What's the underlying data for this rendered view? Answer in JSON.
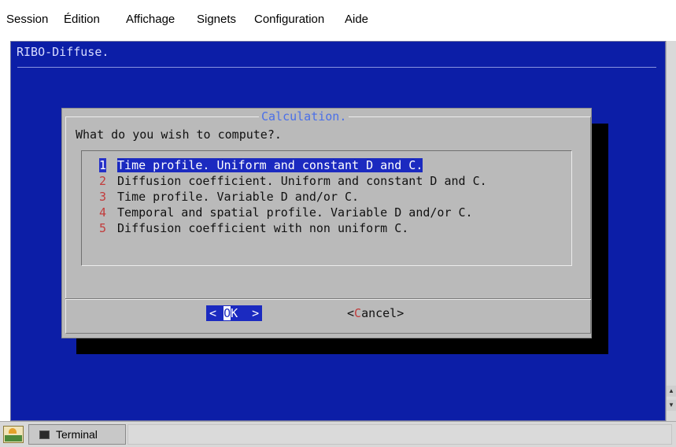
{
  "menubar": {
    "items": [
      "Session",
      "Édition",
      "Affichage",
      "Signets",
      "Configuration",
      "Aide"
    ]
  },
  "terminal": {
    "app_title": "RIBO-Diffuse."
  },
  "dialog": {
    "title": "Calculation.",
    "prompt": "What do you wish to compute?.",
    "items": [
      {
        "tag": "1",
        "label": "Time profile. Uniform and constant D and C.",
        "selected": true
      },
      {
        "tag": "2",
        "label": "Diffusion coefficient. Uniform and constant D and C.",
        "selected": false
      },
      {
        "tag": "3",
        "label": "Time profile. Variable D and/or C.",
        "selected": false
      },
      {
        "tag": "4",
        "label": "Temporal and spatial profile. Variable D and/or C.",
        "selected": false
      },
      {
        "tag": "5",
        "label": "Diffusion coefficient with non uniform C.",
        "selected": false
      }
    ],
    "ok_button": {
      "pre": "< ",
      "hot": "O",
      "post": "K  >"
    },
    "cancel_button": {
      "pre": "<",
      "hot": "C",
      "post": "ancel>"
    }
  },
  "taskbar": {
    "launcher_icon": "desktop-launcher-icon",
    "task_label": "Terminal",
    "task_icon": "terminal-icon"
  },
  "colors": {
    "terminal_bg": "#0c1ea7",
    "dialog_bg": "#bababa",
    "selection": "#1b2ac0",
    "hotkey": "#c23b3b",
    "dialog_title": "#4a6fe8"
  }
}
